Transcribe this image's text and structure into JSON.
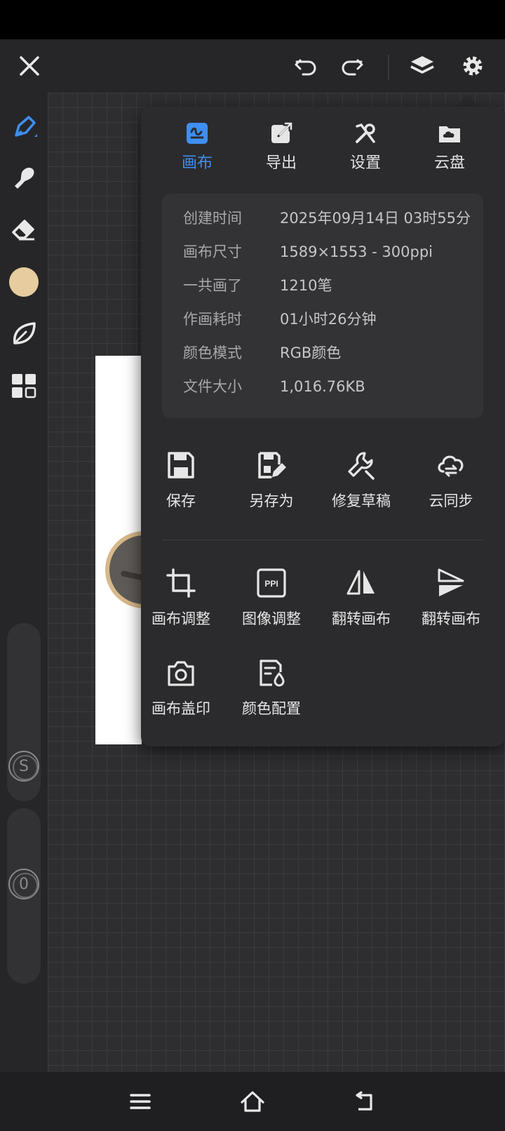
{
  "colors": {
    "accent": "#3f8ef2",
    "panel": "#2b2b2d",
    "brush_color": "#e6cc9e"
  },
  "top_bar": {
    "icons": [
      "close-icon",
      "undo-icon",
      "redo-icon",
      "layers-icon",
      "gear-icon"
    ]
  },
  "left_toolbar": {
    "tools": [
      "pen-icon",
      "smudge-icon",
      "eraser-icon",
      "color-swatch",
      "leaf-icon",
      "grid-icon"
    ],
    "size_slider_label": "S",
    "opacity_slider_label": "0"
  },
  "panel": {
    "tabs": [
      {
        "label": "画布",
        "icon": "canvas-icon",
        "active": true
      },
      {
        "label": "导出",
        "icon": "export-icon",
        "active": false
      },
      {
        "label": "设置",
        "icon": "settings-tools-icon",
        "active": false
      },
      {
        "label": "云盘",
        "icon": "cloud-drive-icon",
        "active": false
      }
    ],
    "info": [
      {
        "key": "创建时间",
        "value": "2025年09月14日 03时55分"
      },
      {
        "key": "画布尺寸",
        "value": "1589×1553 - 300ppi"
      },
      {
        "key": "一共画了",
        "value": "1210笔"
      },
      {
        "key": "作画耗时",
        "value": "01小时26分钟"
      },
      {
        "key": "颜色模式",
        "value": "RGB颜色"
      },
      {
        "key": "文件大小",
        "value": "1,016.76KB"
      }
    ],
    "actions_row1": [
      {
        "label": "保存",
        "icon": "save-icon"
      },
      {
        "label": "另存为",
        "icon": "save-as-icon"
      },
      {
        "label": "修复草稿",
        "icon": "wrench-icon"
      },
      {
        "label": "云同步",
        "icon": "cloud-sync-icon"
      }
    ],
    "actions_row2": [
      {
        "label": "画布调整",
        "icon": "crop-icon"
      },
      {
        "label": "图像调整",
        "icon": "ppi-icon",
        "icon_text": "PPI"
      },
      {
        "label": "翻转画布",
        "icon": "flip-horizontal-icon"
      },
      {
        "label": "翻转画布",
        "icon": "flip-vertical-icon"
      }
    ],
    "actions_row3": [
      {
        "label": "画布盖印",
        "icon": "camera-icon"
      },
      {
        "label": "颜色配置",
        "icon": "color-profile-icon"
      }
    ]
  },
  "nav_bar": {
    "icons": [
      "menu-icon",
      "home-icon",
      "back-icon"
    ]
  }
}
